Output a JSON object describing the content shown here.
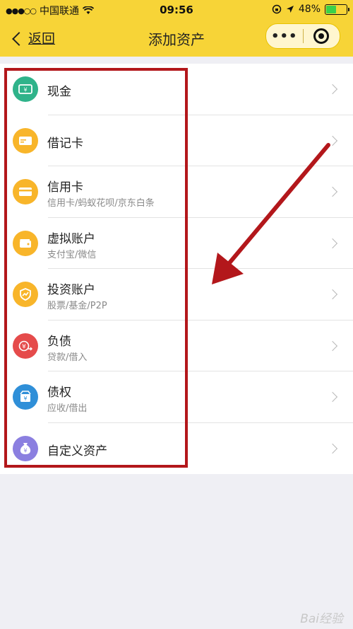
{
  "status": {
    "carrier": "中国联通",
    "time": "09:56",
    "battery": "48%"
  },
  "nav": {
    "back_label": "返回",
    "title": "添加资产",
    "more_label": "•••"
  },
  "items": [
    {
      "label": "现金",
      "sub": "",
      "color": "#2fb38a",
      "icon": "cash-icon"
    },
    {
      "label": "借记卡",
      "sub": "",
      "color": "#f8b52a",
      "icon": "debit-card-icon"
    },
    {
      "label": "信用卡",
      "sub": "信用卡/蚂蚁花呗/京东白条",
      "color": "#f8b52a",
      "icon": "credit-card-icon"
    },
    {
      "label": "虚拟账户",
      "sub": "支付宝/微信",
      "color": "#f8b52a",
      "icon": "wallet-icon"
    },
    {
      "label": "投资账户",
      "sub": "股票/基金/P2P",
      "color": "#f8b52a",
      "icon": "investment-icon"
    },
    {
      "label": "负债",
      "sub": "贷款/借入",
      "color": "#e54b4b",
      "icon": "debt-icon"
    },
    {
      "label": "债权",
      "sub": "应收/借出",
      "color": "#2f8fd8",
      "icon": "claim-icon"
    },
    {
      "label": "自定义资产",
      "sub": "",
      "color": "#8b7fe0",
      "icon": "custom-asset-icon"
    }
  ],
  "annotation": {
    "color": "#b3171b"
  },
  "watermark": "Bai经验"
}
